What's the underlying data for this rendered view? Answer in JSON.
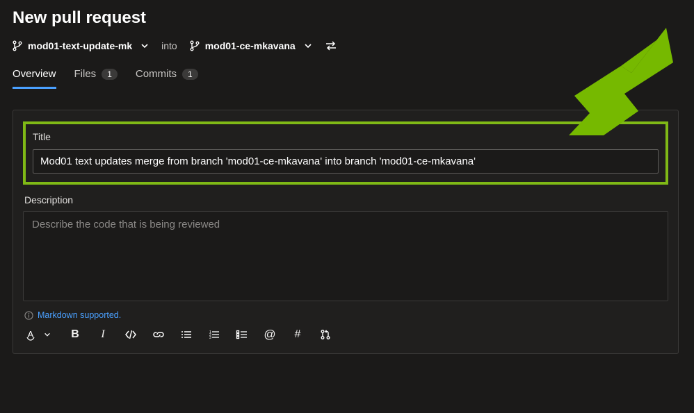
{
  "header": {
    "title": "New pull request"
  },
  "branches": {
    "source": "mod01-text-update-mk",
    "into_label": "into",
    "target": "mod01-ce-mkavana"
  },
  "tabs": {
    "overview": {
      "label": "Overview",
      "active": true
    },
    "files": {
      "label": "Files",
      "count": "1"
    },
    "commits": {
      "label": "Commits",
      "count": "1"
    }
  },
  "form": {
    "title_label": "Title",
    "title_value": "Mod01 text updates merge from branch 'mod01-ce-mkavana' into branch 'mod01-ce-mkavana'",
    "description_label": "Description",
    "description_placeholder": "Describe the code that is being reviewed",
    "markdown_note": "Markdown supported."
  },
  "toolbar": {
    "font_color": "A",
    "bold": "B",
    "italic": "I",
    "mention": "@",
    "hash": "#"
  }
}
